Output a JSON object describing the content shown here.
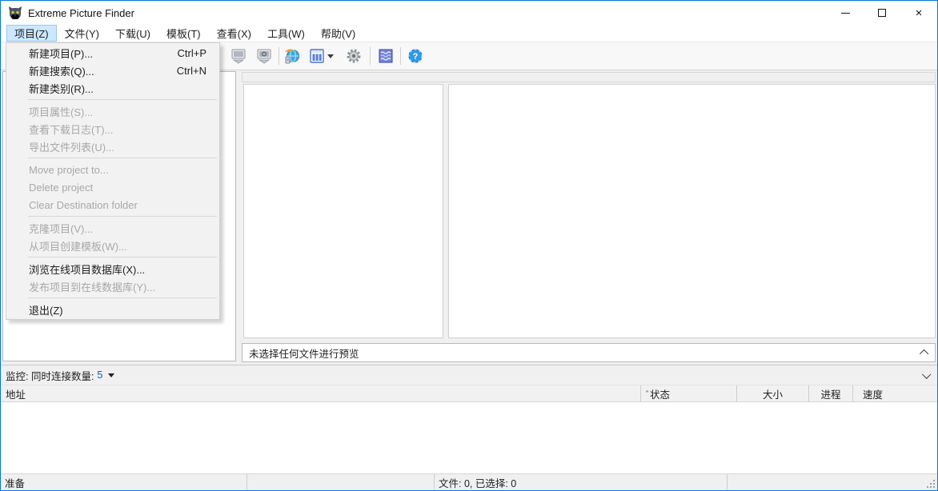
{
  "window": {
    "title": "Extreme Picture Finder",
    "border_color": "#0078d7",
    "icons": {
      "app": "panther-logo-icon",
      "minimize": "minimize-icon",
      "maximize": "maximize-icon",
      "close": "close-icon"
    },
    "close_glyph": "×"
  },
  "menubar": {
    "items": [
      {
        "label": "项目(Z)",
        "active": true
      },
      {
        "label": "文件(Y)",
        "active": false
      },
      {
        "label": "下载(U)",
        "active": false
      },
      {
        "label": "模板(T)",
        "active": false
      },
      {
        "label": "查看(X)",
        "active": false
      },
      {
        "label": "工具(W)",
        "active": false
      },
      {
        "label": "帮助(V)",
        "active": false
      }
    ]
  },
  "project_menu": {
    "items": [
      {
        "label": "新建项目(P)...",
        "shortcut": "Ctrl+P",
        "enabled": true
      },
      {
        "label": "新建搜索(Q)...",
        "shortcut": "Ctrl+N",
        "enabled": true
      },
      {
        "label": "新建类别(R)...",
        "shortcut": "",
        "enabled": true
      },
      {
        "label": "项目属性(S)...",
        "shortcut": "",
        "enabled": false
      },
      {
        "label": "查看下载日志(T)...",
        "shortcut": "",
        "enabled": false
      },
      {
        "label": "导出文件列表(U)...",
        "shortcut": "",
        "enabled": false
      },
      {
        "label": "Move project to...",
        "shortcut": "",
        "enabled": false
      },
      {
        "label": "Delete project",
        "shortcut": "",
        "enabled": false
      },
      {
        "label": "Clear Destination folder",
        "shortcut": "",
        "enabled": false
      },
      {
        "label": "克隆项目(V)...",
        "shortcut": "",
        "enabled": false
      },
      {
        "label": "从项目创建模板(W)...",
        "shortcut": "",
        "enabled": false
      },
      {
        "label": "浏览在线项目数据库(X)...",
        "shortcut": "",
        "enabled": true
      },
      {
        "label": "发布项目到在线数据库(Y)...",
        "shortcut": "",
        "enabled": false
      },
      {
        "label": "退出(Z)",
        "shortcut": "",
        "enabled": true
      }
    ]
  },
  "toolbar": {
    "buttons": [
      {
        "icon": "download-panel-icon"
      },
      {
        "icon": "preview-panel-icon"
      },
      {
        "icon": "browser-icon"
      },
      {
        "icon": "view-mode-icon"
      },
      {
        "icon": "view-mode-dropdown-icon"
      },
      {
        "icon": "settings-gear-icon"
      },
      {
        "icon": "templates-icon"
      },
      {
        "icon": "help-icon"
      }
    ],
    "help_glyph": "?"
  },
  "preview": {
    "message": "未选择任何文件进行预览"
  },
  "monitor": {
    "label": "监控: 同时连接数量:",
    "value": "5"
  },
  "downloads_table": {
    "headers": [
      "地址",
      "状态",
      "大小",
      "进程",
      "速度"
    ],
    "sort_marker": "”",
    "rows": []
  },
  "statusbar": {
    "ready": "准备",
    "files": "文件: 0, 已选择: 0"
  }
}
